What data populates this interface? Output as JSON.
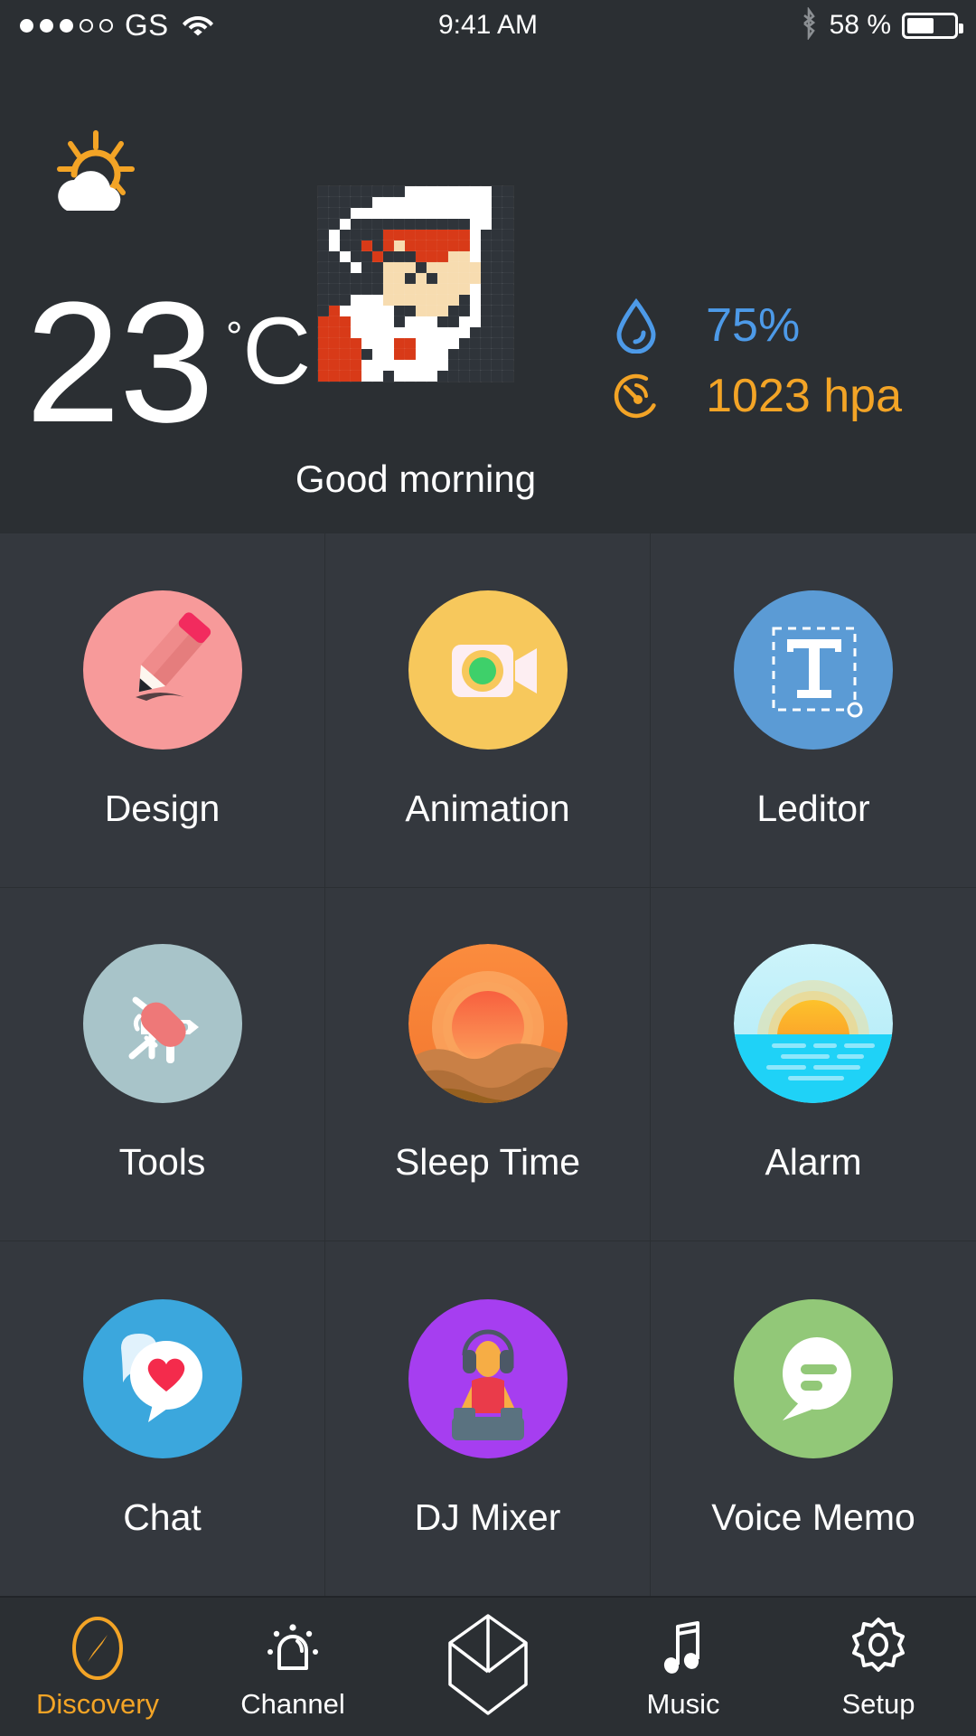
{
  "statusbar": {
    "signal_dots_total": 5,
    "signal_dots_filled": 3,
    "carrier": "GS",
    "wifi_icon": "wifi-icon",
    "time": "9:41 AM",
    "bluetooth_icon": "bluetooth-icon",
    "battery_percent": "58 %",
    "battery_level": 58
  },
  "weather": {
    "condition_icon": "sun-behind-cloud-icon",
    "temperature": "23",
    "unit": "C",
    "degree_symbol": "°",
    "greeting": "Good morning",
    "avatar_icon": "pixel-art-avatar",
    "stats": [
      {
        "icon": "water-drop-icon",
        "value": "75%",
        "color": "#4d9ae8",
        "name": "humidity"
      },
      {
        "icon": "barometer-gauge-icon",
        "value": "1023 hpa",
        "color": "#f3a426",
        "name": "pressure"
      }
    ]
  },
  "apps": [
    {
      "label": "Design",
      "icon": "pencil-icon",
      "bg": "#f79a9a"
    },
    {
      "label": "Animation",
      "icon": "video-camera-icon",
      "bg": "#f7c85c"
    },
    {
      "label": "Leditor",
      "icon": "text-tool-icon",
      "bg": "#5b9bd5"
    },
    {
      "label": "Tools",
      "icon": "swiss-knife-icon",
      "bg": "#a8c4c9"
    },
    {
      "label": "Sleep Time",
      "icon": "sunset-icon",
      "bg": "#f5873c"
    },
    {
      "label": "Alarm",
      "icon": "sunrise-icon",
      "bg": "#2fd2f5"
    },
    {
      "label": "Chat",
      "icon": "heart-bubble-icon",
      "bg": "#3ba7dd"
    },
    {
      "label": "DJ Mixer",
      "icon": "dj-icon",
      "bg": "#a63ef0"
    },
    {
      "label": "Voice Memo",
      "icon": "message-bubble-icon",
      "bg": "#92c878"
    }
  ],
  "tabbar": {
    "active_color": "#f3a426",
    "items": [
      {
        "label": "Discovery",
        "icon": "compass-icon",
        "active": true
      },
      {
        "label": "Channel",
        "icon": "bell-icon",
        "active": false
      },
      {
        "label": "",
        "icon": "cube-icon",
        "active": false
      },
      {
        "label": "Music",
        "icon": "music-note-icon",
        "active": false
      },
      {
        "label": "Setup",
        "icon": "gear-icon",
        "active": false
      }
    ]
  }
}
